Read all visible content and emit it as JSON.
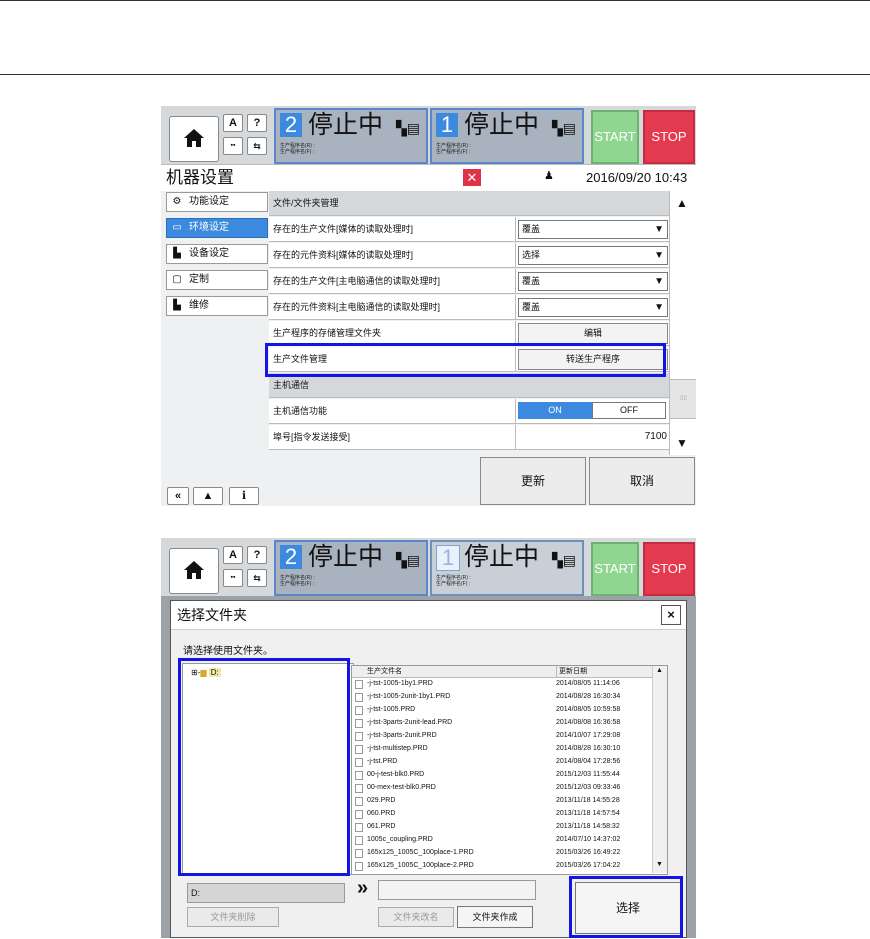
{
  "header_common": {
    "lane2_num": "2",
    "lane1_num": "1",
    "state": "停止中",
    "prog_r_label": "生产程序名(R) :",
    "prog_f_label": "生产程序名(F) :",
    "start": "START",
    "stop": "STOP",
    "help": "?",
    "a_btn": "A"
  },
  "panel1": {
    "title": "机器设置",
    "datetime": "2016/09/20 10:43",
    "nav": [
      {
        "label": "功能设定",
        "icon": "gear-icon"
      },
      {
        "label": "环境设定",
        "icon": "monitor-icon"
      },
      {
        "label": "设备设定",
        "icon": "device-icon"
      },
      {
        "label": "定制",
        "icon": "custom-icon"
      },
      {
        "label": "维修",
        "icon": "wrench-icon"
      }
    ],
    "section1": "文件/文件夹管理",
    "rows": [
      {
        "label": "存在的生产文件[媒体的读取处理时]",
        "value": "覆盖"
      },
      {
        "label": "存在的元件资料[媒体的读取处理时]",
        "value": "选择"
      },
      {
        "label": "存在的生产文件[主电脑通信的读取处理时]",
        "value": "覆盖"
      },
      {
        "label": "存在的元件资料[主电脑通信的读取处理时]",
        "value": "覆盖"
      }
    ],
    "storage_label": "生产程序的存储管理文件夹",
    "storage_btn": "编辑",
    "prodfile_label": "生产文件管理",
    "prodfile_btn": "转送生产程序",
    "section2": "主机通信",
    "host_label": "主机通信功能",
    "on": "ON",
    "off": "OFF",
    "port_label": "埠号[指令发送接受]",
    "port_value": "7100",
    "update_btn": "更新",
    "cancel_btn": "取消"
  },
  "panel2": {
    "dialog_title": "选择文件夹",
    "prompt": "请选择使用文件夹。",
    "tree_root": "D:",
    "col_name": "生产文件名",
    "col_date": "更新日期",
    "files": [
      {
        "name": "-j-tst-1005-1by1.PRD",
        "date": "2014/08/05 11:14:06"
      },
      {
        "name": "-j-tst-1005-2unit-1by1.PRD",
        "date": "2014/08/28 16:30:34"
      },
      {
        "name": "-j-tst-1005.PRD",
        "date": "2014/08/05 10:59:58"
      },
      {
        "name": "-j-tst-3parts-2unit-lead.PRD",
        "date": "2014/08/08 16:36:58"
      },
      {
        "name": "-j-tst-3parts-2unit.PRD",
        "date": "2014/10/07 17:29:08"
      },
      {
        "name": "-j-tst-multistep.PRD",
        "date": "2014/08/28 16:30:10"
      },
      {
        "name": "-j-tst.PRD",
        "date": "2014/08/04 17:28:56"
      },
      {
        "name": "00-j-test-blk0.PRD",
        "date": "2015/12/03 11:55:44"
      },
      {
        "name": "00-mex-test-blk0.PRD",
        "date": "2015/12/03 09:33:46"
      },
      {
        "name": "029.PRD",
        "date": "2013/11/18 14:55:28"
      },
      {
        "name": "060.PRD",
        "date": "2013/11/18 14:57:54"
      },
      {
        "name": "061.PRD",
        "date": "2013/11/18 14:58:32"
      },
      {
        "name": "1005c_coupling.PRD",
        "date": "2014/07/10 14:37:02"
      },
      {
        "name": "165x125_1005C_100place-1.PRD",
        "date": "2015/03/26 16:49:22"
      },
      {
        "name": "165x125_1005C_100place-2.PRD",
        "date": "2015/03/26 17:04:22"
      }
    ],
    "path_value": "D:",
    "del_folder": "文件夹削除",
    "rename_folder": "文件夹改名",
    "make_folder": "文件夹作成",
    "select_btn": "选择",
    "close": "×",
    "arrow": "»"
  }
}
